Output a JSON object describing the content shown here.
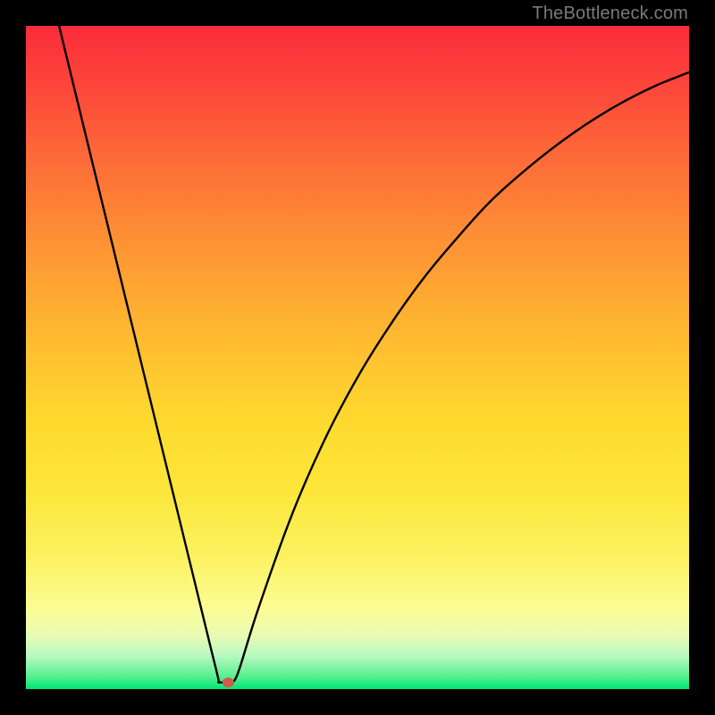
{
  "watermark": "TheBottleneck.com",
  "chart_data": {
    "type": "line",
    "title": "",
    "xlabel": "",
    "ylabel": "",
    "xlim": [
      0,
      100
    ],
    "ylim": [
      0,
      100
    ],
    "background": "rainbow-gradient vertical (red top → green bottom)",
    "series": [
      {
        "name": "bottleneck-curve",
        "x": [
          5,
          10,
          15,
          20,
          25,
          27,
          28,
          29,
          30,
          31,
          32,
          35,
          40,
          45,
          50,
          55,
          60,
          65,
          70,
          75,
          80,
          85,
          90,
          95,
          100
        ],
        "values": [
          100,
          79.5,
          59,
          38.5,
          18,
          9.8,
          5.7,
          1.6,
          1.0,
          1.0,
          2.5,
          12,
          26,
          37.5,
          47,
          55,
          62,
          68,
          73.5,
          78,
          82,
          85.5,
          88.5,
          91,
          93
        ]
      }
    ],
    "marker": {
      "x": 30.5,
      "y": 1.0,
      "color": "#d45a4a"
    },
    "flat_segment": {
      "x0": 29,
      "x1": 31,
      "y": 1.0
    }
  }
}
